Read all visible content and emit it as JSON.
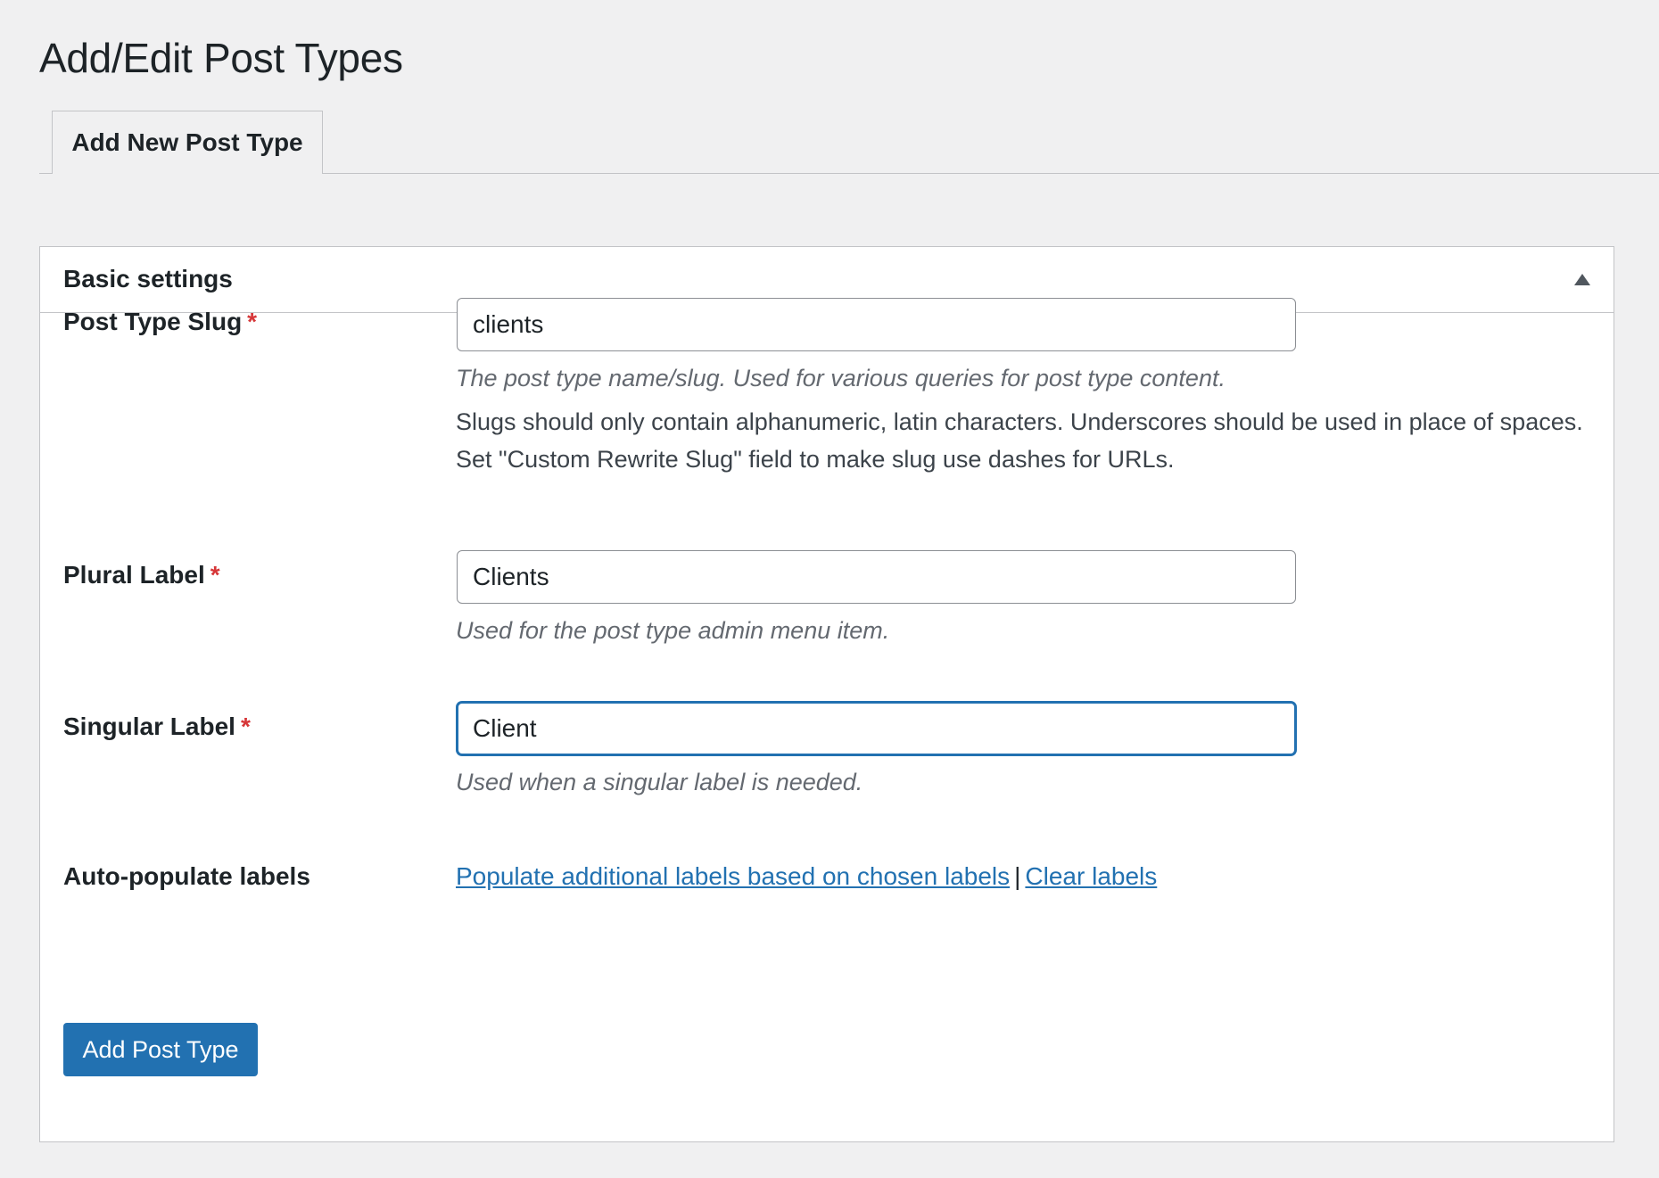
{
  "page": {
    "title": "Add/Edit Post Types"
  },
  "tabs": [
    {
      "label": "Add New Post Type",
      "active": true
    }
  ],
  "panel": {
    "title": "Basic settings",
    "toggle_icon": "triangle-up-icon"
  },
  "fields": {
    "slug": {
      "label": "Post Type Slug",
      "required_mark": "*",
      "value": "clients",
      "description": "The post type name/slug. Used for various queries for post type content.",
      "note": "Slugs should only contain alphanumeric, latin characters. Underscores should be used in place of spaces. Set \"Custom Rewrite Slug\" field to make slug use dashes for URLs."
    },
    "plural": {
      "label": "Plural Label",
      "required_mark": "*",
      "value": "Clients",
      "description": "Used for the post type admin menu item."
    },
    "singular": {
      "label": "Singular Label",
      "required_mark": "*",
      "value": "Client",
      "description": "Used when a singular label is needed."
    }
  },
  "auto_populate": {
    "label": "Auto-populate labels",
    "populate_link": "Populate additional labels based on chosen labels",
    "separator": "|",
    "clear_link": "Clear labels"
  },
  "actions": {
    "submit_label": "Add Post Type"
  },
  "colors": {
    "background": "#f0f0f1",
    "accent": "#2271b1",
    "required": "#d63638",
    "border": "#c3c4c7"
  }
}
